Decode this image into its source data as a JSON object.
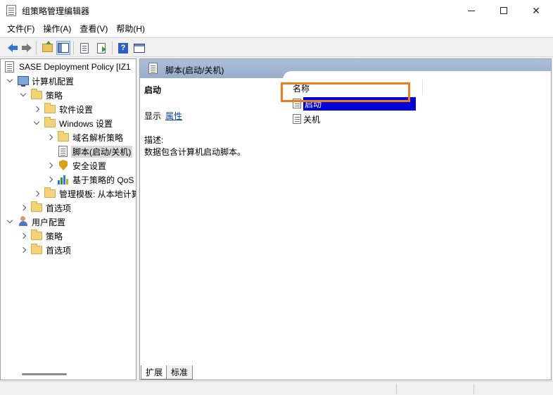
{
  "window": {
    "title": "组策略管理编辑器",
    "controls": [
      "minimize",
      "maximize",
      "close"
    ]
  },
  "menu": {
    "items": [
      "文件(F)",
      "操作(A)",
      "查看(V)",
      "帮助(H)"
    ]
  },
  "toolbar": {
    "buttons": [
      "back-arrow-icon",
      "forward-arrow-icon",
      "folder-up-icon",
      "show-hide-tree-icon",
      "properties-icon",
      "export-list-icon",
      "help-icon",
      "view-icon"
    ]
  },
  "tree": {
    "root": "SASE Deployment Policy [IZ1",
    "items": [
      {
        "label": "计算机配置"
      },
      {
        "label": "策略"
      },
      {
        "label": "软件设置"
      },
      {
        "label": "Windows 设置"
      },
      {
        "label": "域名解析策略"
      },
      {
        "label": "脚本(启动/关机)"
      },
      {
        "label": "安全设置"
      },
      {
        "label": "基于策略的 QoS"
      },
      {
        "label": "管理模板: 从本地计算"
      },
      {
        "label": "首选项"
      },
      {
        "label": "用户配置"
      },
      {
        "label": "策略"
      },
      {
        "label": "首选项"
      }
    ]
  },
  "right_pane": {
    "header_title": "脚本(启动/关机)",
    "ext": {
      "title": "启动",
      "show_label": "显示",
      "properties_link": "属性",
      "desc_label": "描述:",
      "desc_text": "数据包含计算机启动脚本。"
    },
    "list": {
      "column_name": "名称",
      "items": [
        "启动",
        "关机"
      ]
    }
  },
  "tabs": [
    "扩展",
    "标准"
  ],
  "colors": {
    "selection": "#0000d8",
    "highlight": "#f07c1c",
    "header": "#aebfd8"
  }
}
